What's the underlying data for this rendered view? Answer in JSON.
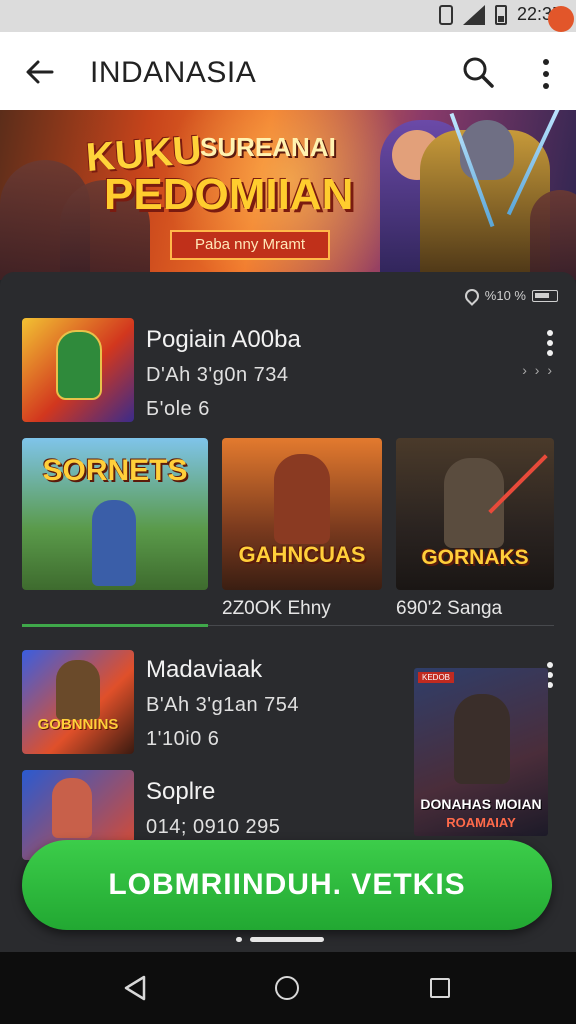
{
  "status_bar": {
    "time": "22:35"
  },
  "app_bar": {
    "title": "INDANASIA"
  },
  "banner": {
    "line1": "KUKU",
    "line1b": "SUREANAI",
    "line2": "PEDOMIIAN",
    "subtitle": "Paba nny Mramt"
  },
  "card": {
    "status_text": "%10 %",
    "item1": {
      "title": "Pogiain A00ba",
      "meta1": "D'Ah 3'g0n 734",
      "meta2": "Б'ole 6"
    },
    "tiles": [
      {
        "title": "SORNETS",
        "caption": ""
      },
      {
        "title": "GAHNCUAS",
        "caption": "2Z0OK Ehny"
      },
      {
        "title": "GORNAKS",
        "caption": "690'2 Sanga"
      }
    ],
    "item2": {
      "title": "Madaviaak",
      "meta1": "B'Ah 3'g1an 754",
      "meta2": "1'10i0 6",
      "thumb_title": "GOBNNINS"
    },
    "item3": {
      "title": "Soplre",
      "meta1": "014; 0910 295"
    },
    "poster": {
      "title": "DONAHAS MOIAN",
      "subtitle": "ROAMAIAY",
      "badge": "KEDOB"
    }
  },
  "cta": {
    "label": "LOBMRIINDUH. VETKIS"
  },
  "colors": {
    "accent_green": "#2fbb3e",
    "banner_orange": "#f0742a",
    "card_bg": "#2a2b2e"
  }
}
